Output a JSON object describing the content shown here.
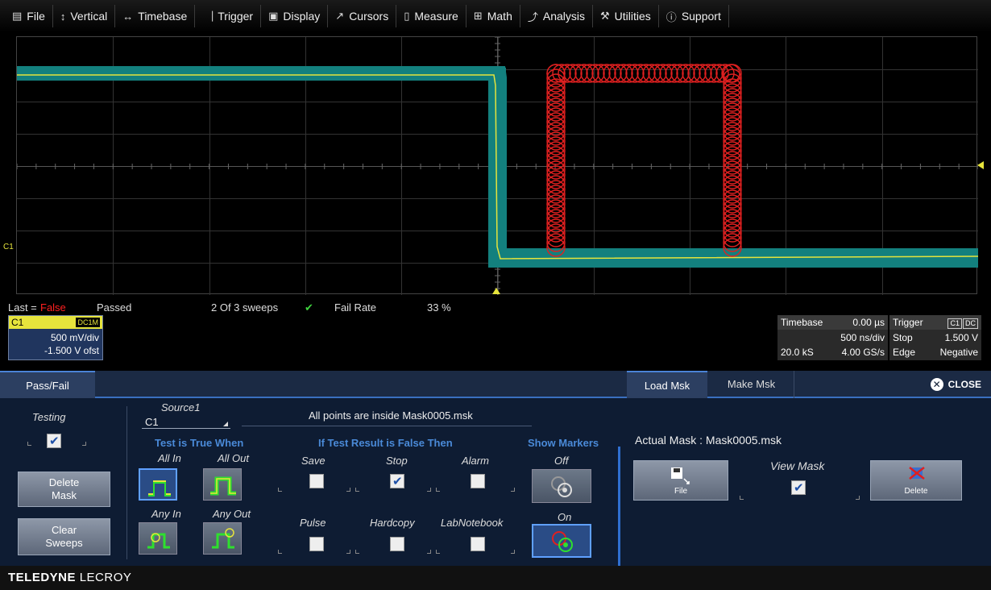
{
  "menu": [
    {
      "icon": "file-icon",
      "glyph": "▤",
      "label": "File"
    },
    {
      "icon": "vertical-icon",
      "glyph": "↕",
      "label": "Vertical"
    },
    {
      "icon": "timebase-icon",
      "glyph": "↔",
      "label": "Timebase"
    },
    {
      "icon": "trigger-icon",
      "glyph": "⎹",
      "label": "Trigger"
    },
    {
      "icon": "display-icon",
      "glyph": "▣",
      "label": "Display"
    },
    {
      "icon": "cursors-icon",
      "glyph": "↗",
      "label": "Cursors"
    },
    {
      "icon": "measure-icon",
      "glyph": "▯",
      "label": "Measure"
    },
    {
      "icon": "math-icon",
      "glyph": "⊞",
      "label": "Math"
    },
    {
      "icon": "analysis-icon",
      "glyph": "⤴",
      "label": "Analysis"
    },
    {
      "icon": "utilities-icon",
      "glyph": "⚒",
      "label": "Utilities"
    },
    {
      "icon": "support-icon",
      "glyph": "ⓘ",
      "label": "Support"
    }
  ],
  "colors": {
    "trace": "#e6e43c",
    "persistence": "#13807e",
    "mask": "#e02020",
    "accent": "#4a8ad8"
  },
  "grid": {
    "channel_label": "C1"
  },
  "status": {
    "last_label": "Last =",
    "last_value": "False",
    "passed_label": "Passed",
    "sweeps": "2 Of 3 sweeps",
    "fail_rate_label": "Fail Rate",
    "fail_rate_value": "33 %"
  },
  "channel": {
    "name": "C1",
    "coupling": "DC1M",
    "vdiv": "500 mV/div",
    "offset": "-1.500 V ofst"
  },
  "timebase": {
    "title": "Timebase",
    "delay": "0.00 µs",
    "tdiv": "500 ns/div",
    "samples": "20.0 kS",
    "rate": "4.00 GS/s"
  },
  "trigger": {
    "title": "Trigger",
    "source": "C1",
    "coupling": "DC",
    "mode": "Stop",
    "level": "1.500 V",
    "type": "Edge",
    "slope": "Negative"
  },
  "panel": {
    "tabs": {
      "passfail": "Pass/Fail",
      "load": "Load Msk",
      "make": "Make Msk",
      "close": "CLOSE"
    },
    "testing_label": "Testing",
    "source_label": "Source1",
    "source_value": "C1",
    "message": "All points are inside Mask0005.msk",
    "test_true_label": "Test is True When",
    "opts": {
      "all_in": "All In",
      "all_out": "All Out",
      "any_in": "Any In",
      "any_out": "Any Out"
    },
    "if_false_label": "If Test Result is False Then",
    "actions": {
      "save": "Save",
      "stop": "Stop",
      "alarm": "Alarm",
      "pulse": "Pulse",
      "hardcopy": "Hardcopy",
      "labnotebook": "LabNotebook"
    },
    "markers_label": "Show Markers",
    "markers_off": "Off",
    "markers_on": "On",
    "delete_mask": "Delete Mask",
    "clear_sweeps": "Clear Sweeps",
    "actual_mask": "Actual Mask : Mask0005.msk",
    "file_btn": "File",
    "view_mask": "View Mask",
    "delete_btn": "Delete"
  },
  "footer": {
    "brand_bold": "TELEDYNE",
    "brand_light": "LECROY"
  }
}
